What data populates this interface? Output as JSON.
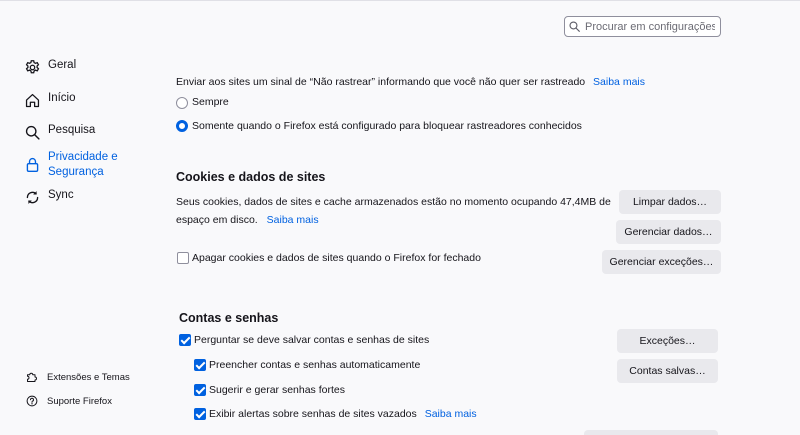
{
  "search": {
    "placeholder": "Procurar em configurações"
  },
  "sidebar": {
    "items": [
      {
        "label": "Geral",
        "icon": "gear-icon"
      },
      {
        "label": "Início",
        "icon": "home-icon"
      },
      {
        "label": "Pesquisa",
        "icon": "search-icon"
      },
      {
        "label_line1": "Privacidade e",
        "label_line2": "Segurança",
        "icon": "lock-icon",
        "active": true
      },
      {
        "label": "Sync",
        "icon": "sync-icon"
      }
    ],
    "footer": [
      {
        "label": "Extensões e Temas",
        "icon": "puzzle-icon"
      },
      {
        "label": "Suporte Firefox",
        "icon": "help-icon"
      }
    ]
  },
  "dnt": {
    "description": "Enviar aos sites um sinal de “Não rastrear” informando que você não quer ser rastreado",
    "learn_more": "Saiba mais",
    "option_always": "Sempre",
    "option_blocking": "Somente quando o Firefox está configurado para bloquear rastreadores conhecidos",
    "selected": "option_blocking"
  },
  "cookies": {
    "title": "Cookies e dados de sites",
    "description_line1": "Seus cookies, dados de sites e cache armazenados estão no momento ocupando 47,4MB de",
    "description_line2": "espaço em disco.",
    "learn_more": "Saiba mais",
    "clear_button": "Limpar dados…",
    "manage_button": "Gerenciar dados…",
    "delete_on_close": "Apagar cookies e dados de sites quando o Firefox for fechado",
    "delete_on_close_checked": false,
    "exceptions_button": "Gerenciar exceções…"
  },
  "logins": {
    "title": "Contas e senhas",
    "ask_to_save": "Perguntar se deve salvar contas e senhas de sites",
    "autofill": "Preencher contas e senhas automaticamente",
    "suggest": "Sugerir e gerar senhas fortes",
    "breach_alerts": "Exibir alertas sobre senhas de sites vazados",
    "learn_more": "Saiba mais",
    "exceptions_button": "Exceções…",
    "saved_button": "Contas salvas…"
  },
  "colors": {
    "accent": "#0061e0",
    "background": "#f9f9fb",
    "button": "#e9e9ed"
  }
}
